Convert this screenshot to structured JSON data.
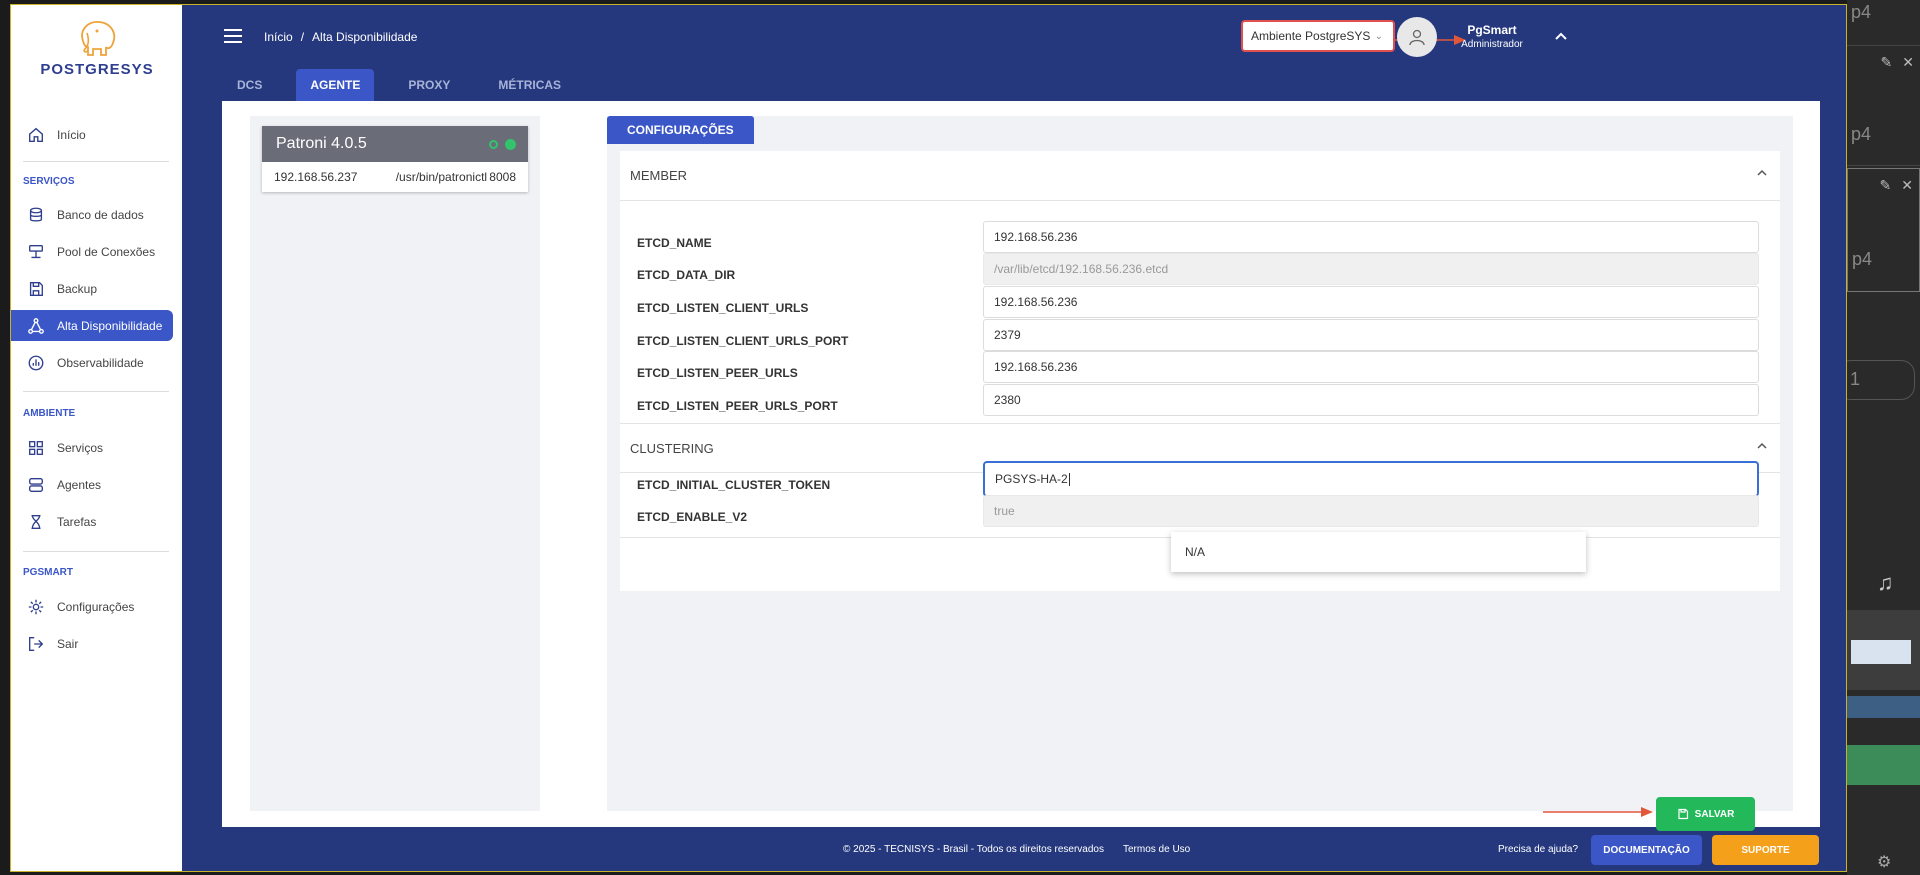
{
  "brand": {
    "name": "POSTGRESYS"
  },
  "sidebar": {
    "home": "Início",
    "sections": {
      "services": "SERVIÇOS",
      "environment": "AMBIENTE",
      "pgsmart": "PGSMART"
    },
    "items": [
      {
        "label": "Banco de dados",
        "icon": "database-icon"
      },
      {
        "label": "Pool de Conexões",
        "icon": "server-icon"
      },
      {
        "label": "Backup",
        "icon": "save-icon"
      },
      {
        "label": "Alta Disponibilidade",
        "icon": "cluster-icon"
      },
      {
        "label": "Observabilidade",
        "icon": "chart-icon"
      },
      {
        "label": "Serviços",
        "icon": "grid-icon"
      },
      {
        "label": "Agentes",
        "icon": "agents-icon"
      },
      {
        "label": "Tarefas",
        "icon": "hourglass-icon"
      },
      {
        "label": "Configurações",
        "icon": "gear-icon"
      },
      {
        "label": "Sair",
        "icon": "logout-icon"
      }
    ],
    "active": "Alta Disponibilidade"
  },
  "header": {
    "breadcrumb": {
      "home": "Início",
      "separator": "/",
      "current": "Alta Disponibilidade"
    },
    "environment": "Ambiente PostgreSYS",
    "user": {
      "name": "PgSmart",
      "role": "Administrador"
    }
  },
  "tabs": [
    "DCS",
    "AGENTE",
    "PROXY",
    "MÉTRICAS"
  ],
  "active_tab": "AGENTE",
  "patroni": {
    "title": "Patroni 4.0.5",
    "ip": "192.168.56.237",
    "path": "/usr/bin/patronictl",
    "port": "8008"
  },
  "config": {
    "tab_label": "CONFIGURAÇÕES",
    "member": {
      "title": "MEMBER",
      "fields": [
        {
          "label": "ETCD_NAME",
          "value": "192.168.56.236"
        },
        {
          "label": "ETCD_DATA_DIR",
          "value": "/var/lib/etcd/192.168.56.236.etcd"
        },
        {
          "label": "ETCD_LISTEN_CLIENT_URLS",
          "value": "192.168.56.236"
        },
        {
          "label": "ETCD_LISTEN_CLIENT_URLS_PORT",
          "value": "2379"
        },
        {
          "label": "ETCD_LISTEN_PEER_URLS",
          "value": "192.168.56.236"
        },
        {
          "label": "ETCD_LISTEN_PEER_URLS_PORT",
          "value": "2380"
        }
      ]
    },
    "clustering": {
      "title": "CLUSTERING",
      "fields": [
        {
          "label": "ETCD_INITIAL_CLUSTER_TOKEN",
          "value": "PGSYS-HA-2"
        },
        {
          "label": "ETCD_ENABLE_V2",
          "value": "true"
        }
      ]
    },
    "dropdown_option": "N/A",
    "save_label": "SALVAR"
  },
  "footer": {
    "copyright": "© 2025 - TECNISYS - Brasil - Todos os direitos reservados",
    "terms": "Termos de Uso",
    "help": "Precisa de ajuda?",
    "docs_label": "DOCUMENTAÇÃO",
    "support_label": "SUPORTE"
  },
  "background_window": {
    "labels": [
      "p4",
      "p4",
      "p4",
      "1"
    ]
  },
  "colors": {
    "primary": "#25387d",
    "accent": "#3a56c7",
    "success": "#23b85a",
    "warning": "#f5a01a",
    "annotation_arrow": "#e2573a"
  }
}
